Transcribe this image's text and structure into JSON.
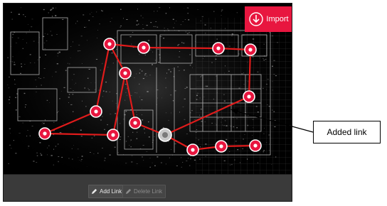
{
  "toolbar": {
    "add_link_label": "Add Link",
    "delete_link_label": "Delete Link",
    "import_label": "Import"
  },
  "callout": {
    "label": "Added link"
  },
  "icons": {
    "add_link": "pencil-icon",
    "delete_link": "pencil-icon",
    "import": "download-arrow-icon"
  },
  "colors": {
    "accent": "#e8163f",
    "path_line": "#e01b1b",
    "node_fill": "#e8163f",
    "selected_node": "#c8c8c8"
  }
}
